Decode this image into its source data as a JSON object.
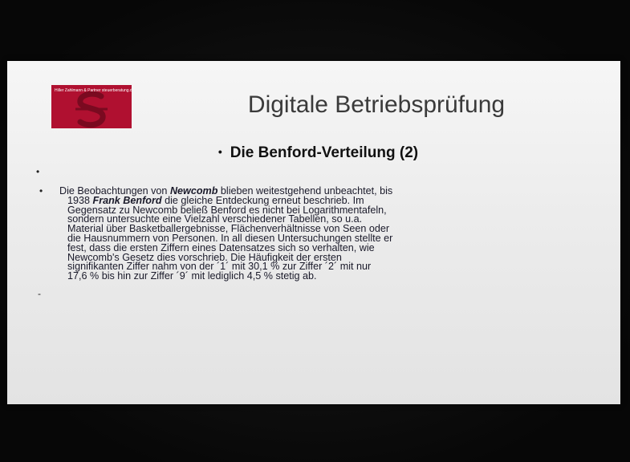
{
  "slide": {
    "logo_text": "Hiller Zahlmann & Partner steuerberatung.de",
    "title": "Digitale Betriebsprüfung",
    "subtitle": "Die Benford-Verteilung (2)",
    "bullet_glyph": "•",
    "dash_glyph": "-",
    "body": {
      "l1_a": "Die Beobachtungen von ",
      "l1_b": "Newcomb",
      "l1_c": " blieben weitestgehend unbeachtet, bis",
      "l2_a": "1938 ",
      "l2_b": "Frank Benford",
      "l2_c": " die gleiche Entdeckung erneut beschrieb. Im",
      "l3": "Gegensatz zu Newcomb beließ Benford es nicht bei Logarithmentafeln,",
      "l4": "sondern untersuchte eine Vielzahl verschiedener Tabellen, so u.a.",
      "l5": "Material über Basketballergebnisse, Flächenverhältnisse von Seen oder",
      "l6": "die Hausnummern von Personen. In all diesen Untersuchungen stellte er",
      "l7": "fest, dass die ersten Ziffern eines Datensatzes sich so verhalten, wie",
      "l8": "Newcomb's Gesetz dies vorschrieb. Die Häufigkeit der ersten",
      "l9": "signifikanten Ziffer nahm von der ´1´ mit 30,1 % zur Ziffer ´2´ mit nur",
      "l10": "17,6 % bis hin zur Ziffer ´9´ mit lediglich 4,5 % stetig ab."
    }
  }
}
